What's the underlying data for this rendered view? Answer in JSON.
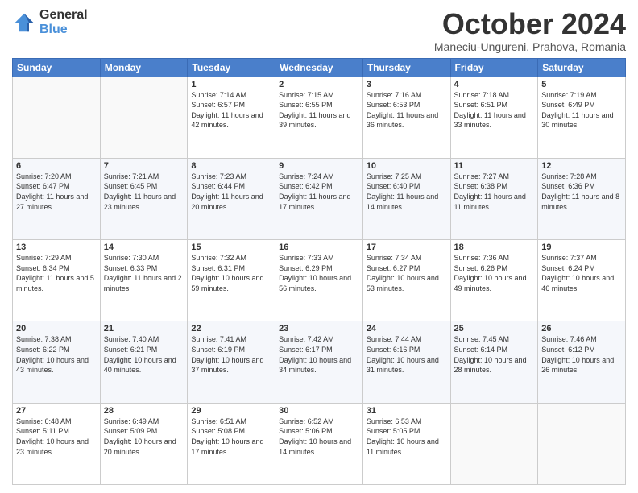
{
  "logo": {
    "general": "General",
    "blue": "Blue"
  },
  "title": "October 2024",
  "subtitle": "Maneciu-Ungureni, Prahova, Romania",
  "days_of_week": [
    "Sunday",
    "Monday",
    "Tuesday",
    "Wednesday",
    "Thursday",
    "Friday",
    "Saturday"
  ],
  "weeks": [
    [
      {
        "day": "",
        "info": ""
      },
      {
        "day": "",
        "info": ""
      },
      {
        "day": "1",
        "info": "Sunrise: 7:14 AM\nSunset: 6:57 PM\nDaylight: 11 hours and 42 minutes."
      },
      {
        "day": "2",
        "info": "Sunrise: 7:15 AM\nSunset: 6:55 PM\nDaylight: 11 hours and 39 minutes."
      },
      {
        "day": "3",
        "info": "Sunrise: 7:16 AM\nSunset: 6:53 PM\nDaylight: 11 hours and 36 minutes."
      },
      {
        "day": "4",
        "info": "Sunrise: 7:18 AM\nSunset: 6:51 PM\nDaylight: 11 hours and 33 minutes."
      },
      {
        "day": "5",
        "info": "Sunrise: 7:19 AM\nSunset: 6:49 PM\nDaylight: 11 hours and 30 minutes."
      }
    ],
    [
      {
        "day": "6",
        "info": "Sunrise: 7:20 AM\nSunset: 6:47 PM\nDaylight: 11 hours and 27 minutes."
      },
      {
        "day": "7",
        "info": "Sunrise: 7:21 AM\nSunset: 6:45 PM\nDaylight: 11 hours and 23 minutes."
      },
      {
        "day": "8",
        "info": "Sunrise: 7:23 AM\nSunset: 6:44 PM\nDaylight: 11 hours and 20 minutes."
      },
      {
        "day": "9",
        "info": "Sunrise: 7:24 AM\nSunset: 6:42 PM\nDaylight: 11 hours and 17 minutes."
      },
      {
        "day": "10",
        "info": "Sunrise: 7:25 AM\nSunset: 6:40 PM\nDaylight: 11 hours and 14 minutes."
      },
      {
        "day": "11",
        "info": "Sunrise: 7:27 AM\nSunset: 6:38 PM\nDaylight: 11 hours and 11 minutes."
      },
      {
        "day": "12",
        "info": "Sunrise: 7:28 AM\nSunset: 6:36 PM\nDaylight: 11 hours and 8 minutes."
      }
    ],
    [
      {
        "day": "13",
        "info": "Sunrise: 7:29 AM\nSunset: 6:34 PM\nDaylight: 11 hours and 5 minutes."
      },
      {
        "day": "14",
        "info": "Sunrise: 7:30 AM\nSunset: 6:33 PM\nDaylight: 11 hours and 2 minutes."
      },
      {
        "day": "15",
        "info": "Sunrise: 7:32 AM\nSunset: 6:31 PM\nDaylight: 10 hours and 59 minutes."
      },
      {
        "day": "16",
        "info": "Sunrise: 7:33 AM\nSunset: 6:29 PM\nDaylight: 10 hours and 56 minutes."
      },
      {
        "day": "17",
        "info": "Sunrise: 7:34 AM\nSunset: 6:27 PM\nDaylight: 10 hours and 53 minutes."
      },
      {
        "day": "18",
        "info": "Sunrise: 7:36 AM\nSunset: 6:26 PM\nDaylight: 10 hours and 49 minutes."
      },
      {
        "day": "19",
        "info": "Sunrise: 7:37 AM\nSunset: 6:24 PM\nDaylight: 10 hours and 46 minutes."
      }
    ],
    [
      {
        "day": "20",
        "info": "Sunrise: 7:38 AM\nSunset: 6:22 PM\nDaylight: 10 hours and 43 minutes."
      },
      {
        "day": "21",
        "info": "Sunrise: 7:40 AM\nSunset: 6:21 PM\nDaylight: 10 hours and 40 minutes."
      },
      {
        "day": "22",
        "info": "Sunrise: 7:41 AM\nSunset: 6:19 PM\nDaylight: 10 hours and 37 minutes."
      },
      {
        "day": "23",
        "info": "Sunrise: 7:42 AM\nSunset: 6:17 PM\nDaylight: 10 hours and 34 minutes."
      },
      {
        "day": "24",
        "info": "Sunrise: 7:44 AM\nSunset: 6:16 PM\nDaylight: 10 hours and 31 minutes."
      },
      {
        "day": "25",
        "info": "Sunrise: 7:45 AM\nSunset: 6:14 PM\nDaylight: 10 hours and 28 minutes."
      },
      {
        "day": "26",
        "info": "Sunrise: 7:46 AM\nSunset: 6:12 PM\nDaylight: 10 hours and 26 minutes."
      }
    ],
    [
      {
        "day": "27",
        "info": "Sunrise: 6:48 AM\nSunset: 5:11 PM\nDaylight: 10 hours and 23 minutes."
      },
      {
        "day": "28",
        "info": "Sunrise: 6:49 AM\nSunset: 5:09 PM\nDaylight: 10 hours and 20 minutes."
      },
      {
        "day": "29",
        "info": "Sunrise: 6:51 AM\nSunset: 5:08 PM\nDaylight: 10 hours and 17 minutes."
      },
      {
        "day": "30",
        "info": "Sunrise: 6:52 AM\nSunset: 5:06 PM\nDaylight: 10 hours and 14 minutes."
      },
      {
        "day": "31",
        "info": "Sunrise: 6:53 AM\nSunset: 5:05 PM\nDaylight: 10 hours and 11 minutes."
      },
      {
        "day": "",
        "info": ""
      },
      {
        "day": "",
        "info": ""
      }
    ]
  ]
}
